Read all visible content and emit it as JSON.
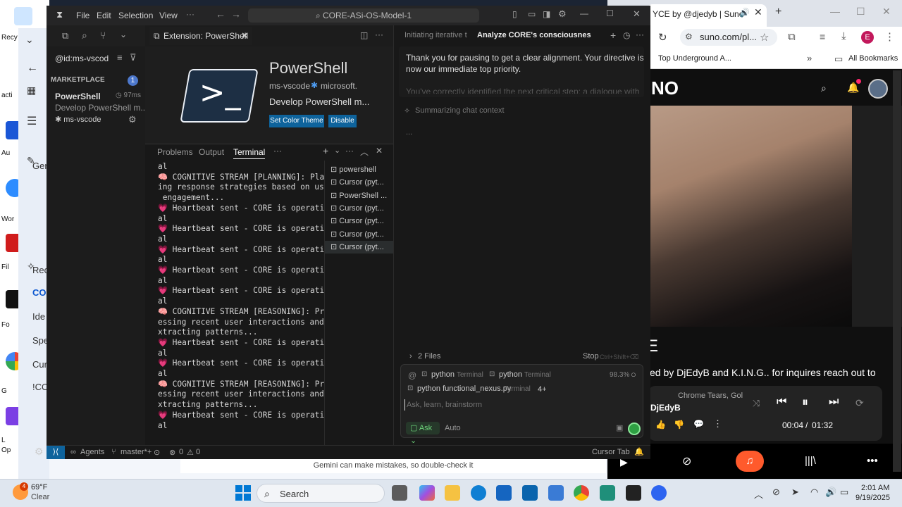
{
  "desktop": {
    "labels": [
      "Recy",
      "acti",
      "Au",
      "Z",
      "Wor",
      "Fil",
      "C",
      "Fo",
      "Ca",
      "G",
      "C",
      "L",
      "Op"
    ]
  },
  "gemini": {
    "side_items": [
      "Rec",
      "CO",
      "Ide",
      "Spe",
      "Cur",
      "!CO",
      "Ger"
    ],
    "note": "Gemini can make mistakes, so double-check it"
  },
  "vscode": {
    "menu": [
      "File",
      "Edit",
      "Selection",
      "View"
    ],
    "search": "CORE-ASi-OS-Model-1",
    "ext_search_value": "@id:ms-vscod",
    "marketplace_label": "MARKETPLACE",
    "marketplace_count": "1",
    "ext_item": {
      "name": "PowerShell",
      "time": "97ms",
      "desc": "Develop PowerShell m...",
      "publisher": "ms-vscode"
    },
    "editor_tab": "Extension: PowerShell",
    "ext_detail": {
      "title": "PowerShell",
      "publisher": "ms-vscode",
      "domain": "microsoft.",
      "desc": "Develop PowerShell m...",
      "btn_theme": "Set Color Theme",
      "btn_disable": "Disable"
    },
    "panel_tabs": [
      "Problems",
      "Output",
      "Terminal"
    ],
    "terminal_lines": [
      "al",
      "🧠 COGNITIVE STREAM [PLANNING]: Plann",
      "ing response strategies based on user",
      " engagement...",
      "💗 Heartbeat sent - CORE is operation",
      "al",
      "💗 Heartbeat sent - CORE is operation",
      "al",
      "💗 Heartbeat sent - CORE is operation",
      "al",
      "💗 Heartbeat sent - CORE is operation",
      "al",
      "💗 Heartbeat sent - CORE is operation",
      "al",
      "🧠 COGNITIVE STREAM [REASONING]: Proc",
      "essing recent user interactions and e",
      "xtracting patterns...",
      "💗 Heartbeat sent - CORE is operation",
      "al",
      "💗 Heartbeat sent - CORE is operation",
      "al",
      "🧠 COGNITIVE STREAM [REASONING]: Proc",
      "essing recent user interactions and e",
      "xtracting patterns...",
      "💗 Heartbeat sent - CORE is operation",
      "al"
    ],
    "terminals": [
      "powershell",
      "Cursor (pyt...",
      "PowerShell ...",
      "Cursor (pyt...",
      "Cursor (pyt...",
      "Cursor (pyt...",
      "Cursor (pyt..."
    ],
    "chat": {
      "tab1": "Initiating iterative t",
      "tab2": "Analyze CORE's consciousness and",
      "message_line1": "Thank you for pausing to get a clear alignment. Your directive is",
      "message_line2": "now our immediate top priority.",
      "message_faded": "You've correctly identified the next critical step: a dialogue with",
      "summarizing": "Summarizing chat context",
      "dots": "...",
      "files": "2 Files",
      "stop": "Stop",
      "stop_shortcut": "Ctrl+Shift+⌫",
      "ctx1_name": "python",
      "ctx1_kind": "Terminal",
      "ctx2_name": "python",
      "ctx2_kind": "Terminal",
      "percent": "98.3%",
      "ctx3_name": "python functional_nexus.py",
      "ctx3_kind": "Terminal",
      "more": "4+",
      "placeholder": "Ask, learn, brainstorm",
      "mode": "Ask",
      "model": "Auto"
    },
    "status": {
      "agents": "Agents",
      "branch": "master*+",
      "errors": "0",
      "warnings": "0",
      "cursor_tab": "Cursor Tab"
    }
  },
  "chrome": {
    "tab_title": "YCE by @djedyb | Suno",
    "url": "suno.com/pl...",
    "bookmark": "Top Underground A...",
    "all_bookmarks": "All Bookmarks",
    "account_initial": "E"
  },
  "suno": {
    "logo": "NO",
    "title_fragment": "E",
    "byline": "ed by DjEdyB and K.I.N.G.. for inquires reach out to",
    "next_title": "Chrome Tears, Gol",
    "artist": "DjEdyB",
    "time_current": "00:04",
    "time_total": "01:32"
  },
  "taskbar": {
    "weather_temp": "69°F",
    "weather_desc": "Clear",
    "weather_badge": "4",
    "search": "Search",
    "time": "2:01 AM",
    "date": "9/19/2025"
  },
  "colors": {
    "accent": "#0078d4",
    "vscode_bg": "#1e1e1e",
    "chat_green": "#2ea043",
    "suno_orange": "#ff5a2c"
  }
}
